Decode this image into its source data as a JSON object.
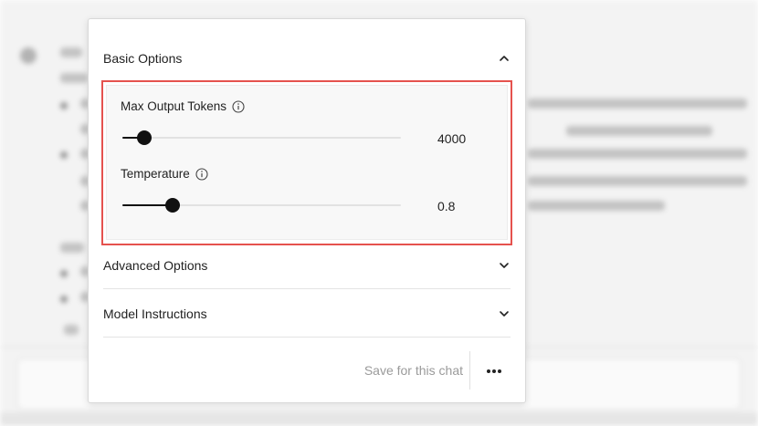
{
  "panel": {
    "basic_options": {
      "title": "Basic Options",
      "expanded": true,
      "max_output_tokens": {
        "label": "Max Output Tokens",
        "value": "4000",
        "slider_fraction": 0.08
      },
      "temperature": {
        "label": "Temperature",
        "value": "0.8",
        "slider_fraction": 0.18
      }
    },
    "advanced_options": {
      "title": "Advanced Options",
      "expanded": false
    },
    "model_instructions": {
      "title": "Model Instructions",
      "expanded": false
    },
    "footer": {
      "save_label": "Save for this chat",
      "more_icon": "more-horizontal-icon"
    }
  },
  "colors": {
    "highlight": "#e5524e",
    "slider_active": "#111111"
  }
}
